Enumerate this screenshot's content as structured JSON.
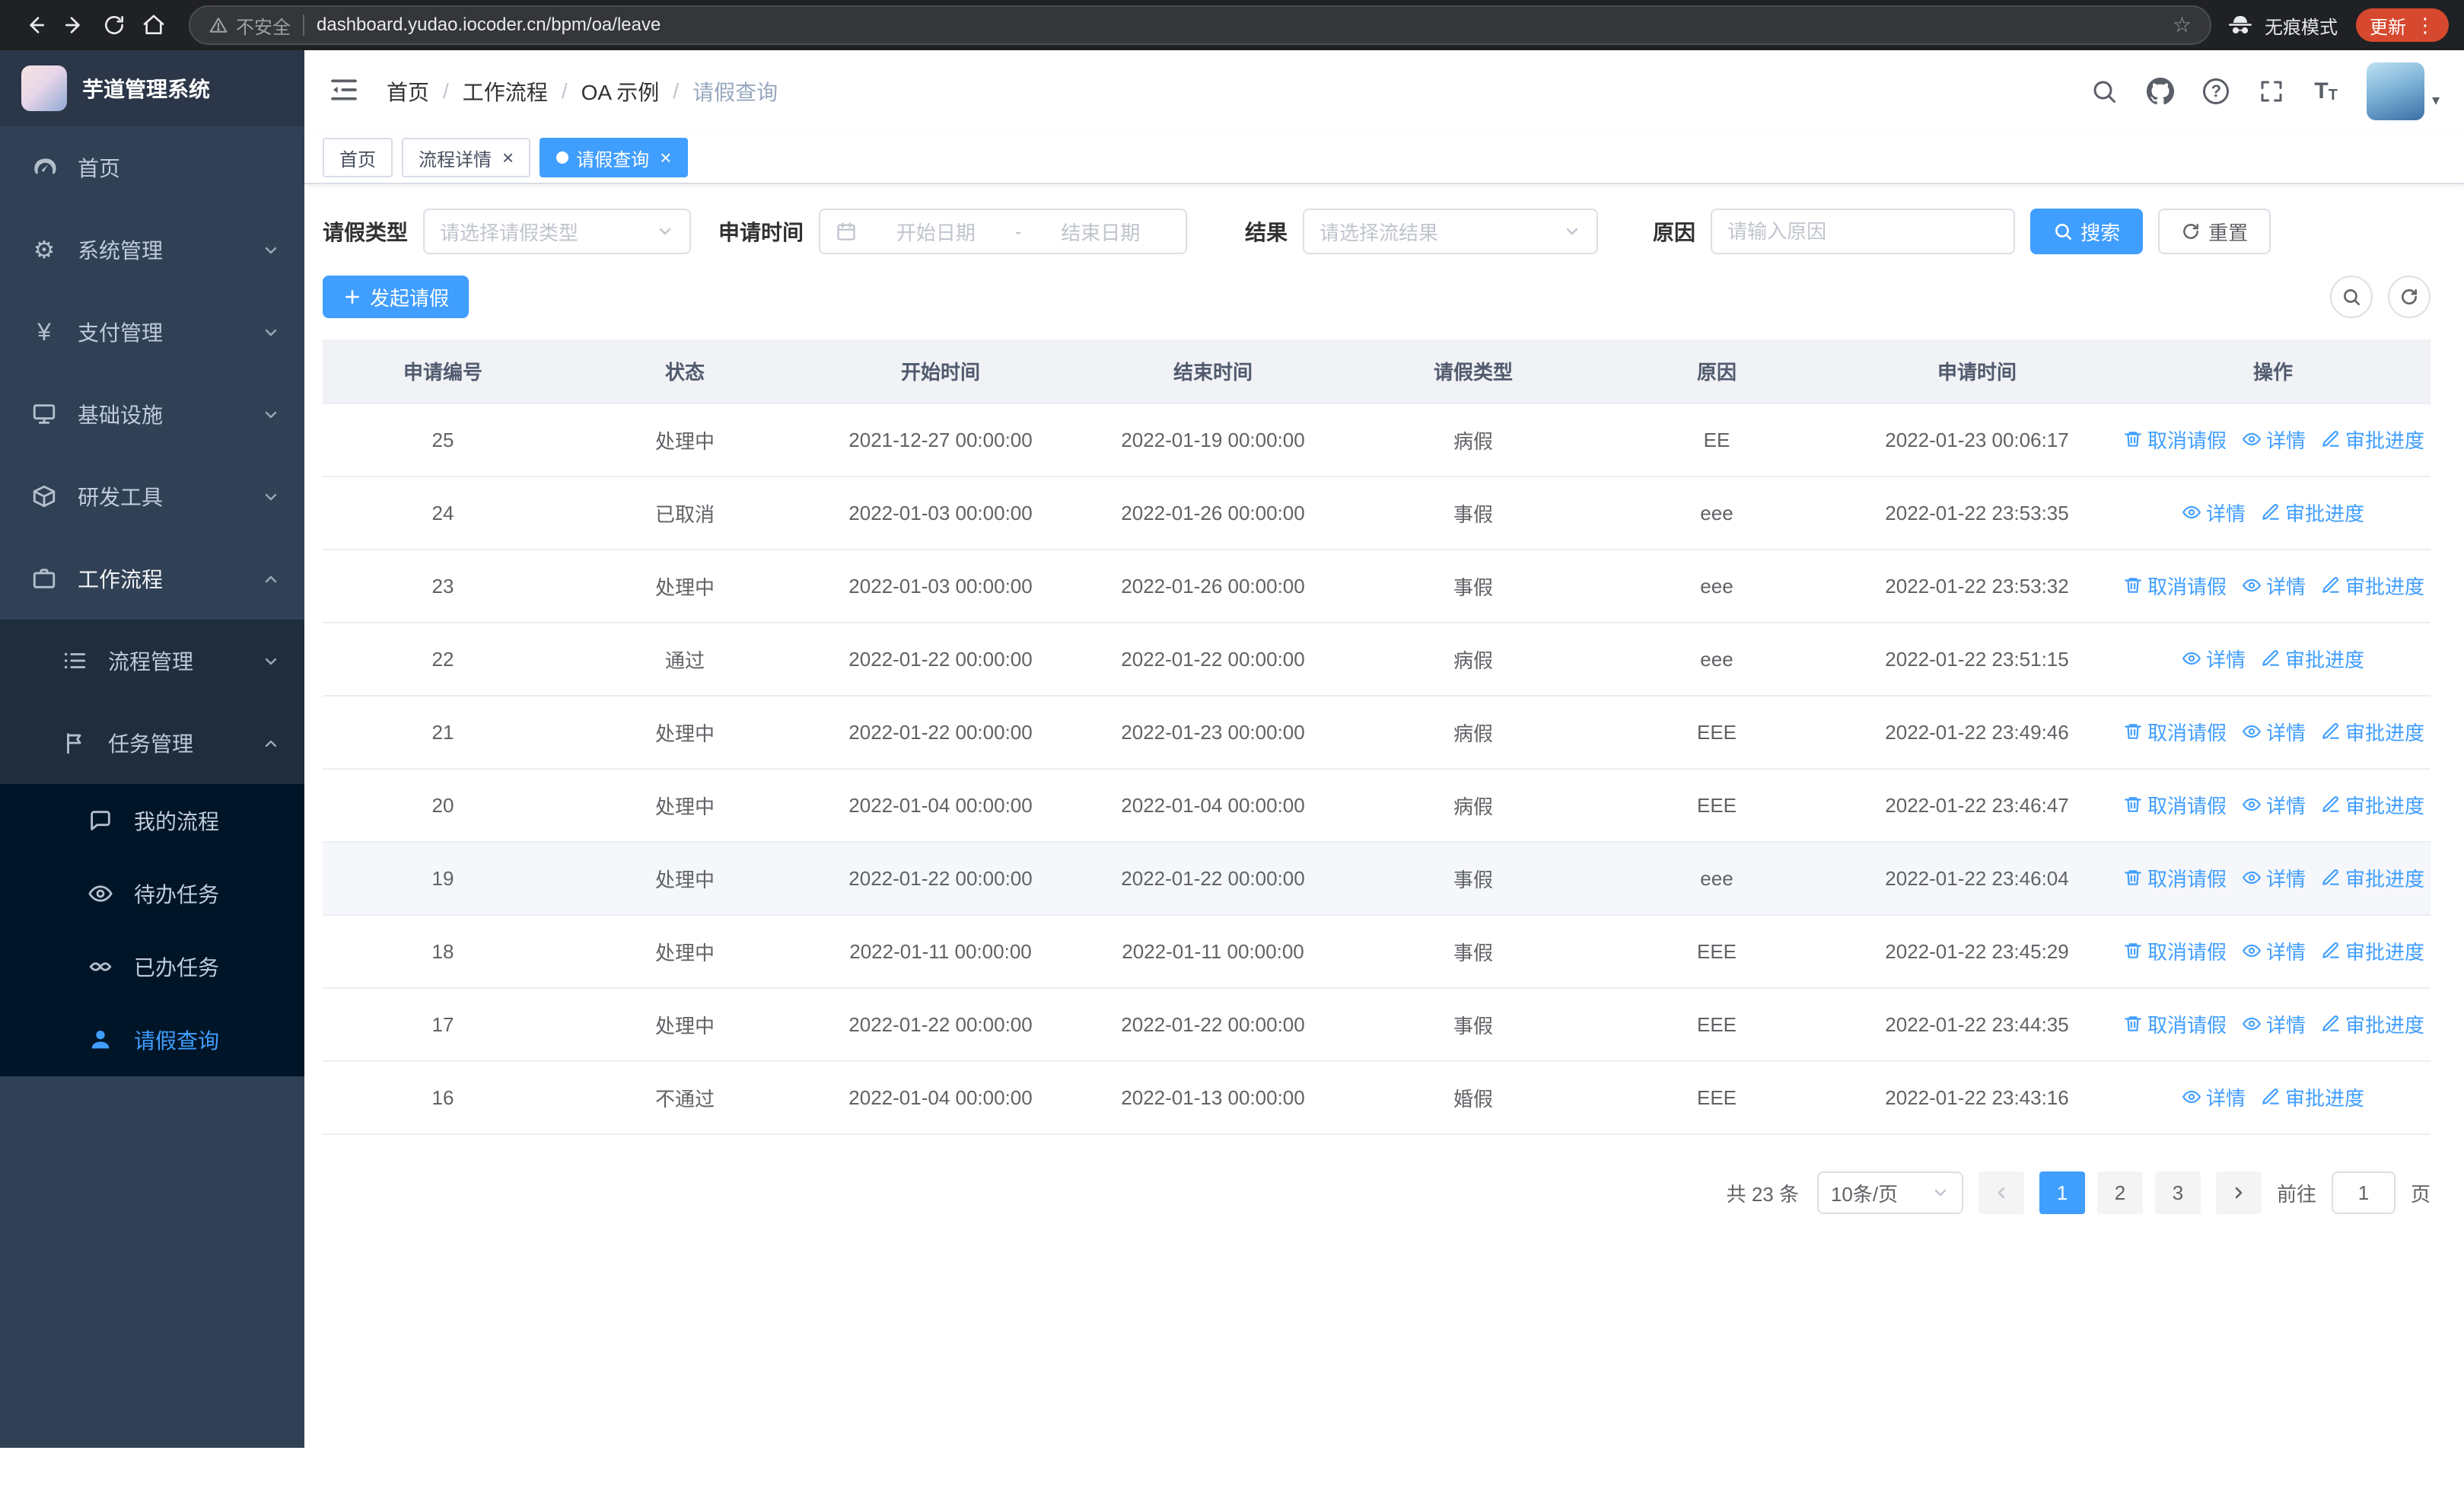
{
  "chrome": {
    "security_warning": "不安全",
    "url": "dashboard.yudao.iocoder.cn/bpm/oa/leave",
    "incognito_label": "无痕模式",
    "update_label": "更新"
  },
  "sidebar": {
    "logo_title": "芋道管理系统",
    "items": [
      "首页",
      "系统管理",
      "支付管理",
      "基础设施",
      "研发工具",
      "工作流程"
    ],
    "sub_items": [
      "流程管理",
      "任务管理"
    ],
    "leaf_items": [
      "我的流程",
      "待办任务",
      "已办任务",
      "请假查询"
    ]
  },
  "navbar": {
    "breadcrumb": [
      "首页",
      "工作流程",
      "OA 示例",
      "请假查询"
    ]
  },
  "tabs": [
    "首页",
    "流程详情",
    "请假查询"
  ],
  "filters": {
    "leave_type_label": "请假类型",
    "leave_type_placeholder": "请选择请假类型",
    "apply_time_label": "申请时间",
    "start_date_placeholder": "开始日期",
    "range_separator": "-",
    "end_date_placeholder": "结束日期",
    "result_label": "结果",
    "result_placeholder": "请选择流结果",
    "reason_label": "原因",
    "reason_placeholder": "请输入原因",
    "search_button": "搜索",
    "reset_button": "重置"
  },
  "toolbar": {
    "create_button": "发起请假"
  },
  "table": {
    "columns": [
      "申请编号",
      "状态",
      "开始时间",
      "结束时间",
      "请假类型",
      "原因",
      "申请时间",
      "操作"
    ],
    "action_cancel": "取消请假",
    "action_detail": "详情",
    "action_progress": "审批进度",
    "rows": [
      {
        "id": "25",
        "status": "处理中",
        "start": "2021-12-27 00:00:00",
        "end": "2022-01-19 00:00:00",
        "type": "病假",
        "reason": "EE",
        "applyTime": "2022-01-23 00:06:17",
        "cancelable": true,
        "hover": false
      },
      {
        "id": "24",
        "status": "已取消",
        "start": "2022-01-03 00:00:00",
        "end": "2022-01-26 00:00:00",
        "type": "事假",
        "reason": "eee",
        "applyTime": "2022-01-22 23:53:35",
        "cancelable": false,
        "hover": false
      },
      {
        "id": "23",
        "status": "处理中",
        "start": "2022-01-03 00:00:00",
        "end": "2022-01-26 00:00:00",
        "type": "事假",
        "reason": "eee",
        "applyTime": "2022-01-22 23:53:32",
        "cancelable": true,
        "hover": false
      },
      {
        "id": "22",
        "status": "通过",
        "start": "2022-01-22 00:00:00",
        "end": "2022-01-22 00:00:00",
        "type": "病假",
        "reason": "eee",
        "applyTime": "2022-01-22 23:51:15",
        "cancelable": false,
        "hover": false
      },
      {
        "id": "21",
        "status": "处理中",
        "start": "2022-01-22 00:00:00",
        "end": "2022-01-23 00:00:00",
        "type": "病假",
        "reason": "EEE",
        "applyTime": "2022-01-22 23:49:46",
        "cancelable": true,
        "hover": false
      },
      {
        "id": "20",
        "status": "处理中",
        "start": "2022-01-04 00:00:00",
        "end": "2022-01-04 00:00:00",
        "type": "病假",
        "reason": "EEE",
        "applyTime": "2022-01-22 23:46:47",
        "cancelable": true,
        "hover": false
      },
      {
        "id": "19",
        "status": "处理中",
        "start": "2022-01-22 00:00:00",
        "end": "2022-01-22 00:00:00",
        "type": "事假",
        "reason": "eee",
        "applyTime": "2022-01-22 23:46:04",
        "cancelable": true,
        "hover": true
      },
      {
        "id": "18",
        "status": "处理中",
        "start": "2022-01-11 00:00:00",
        "end": "2022-01-11 00:00:00",
        "type": "事假",
        "reason": "EEE",
        "applyTime": "2022-01-22 23:45:29",
        "cancelable": true,
        "hover": false
      },
      {
        "id": "17",
        "status": "处理中",
        "start": "2022-01-22 00:00:00",
        "end": "2022-01-22 00:00:00",
        "type": "事假",
        "reason": "EEE",
        "applyTime": "2022-01-22 23:44:35",
        "cancelable": true,
        "hover": false
      },
      {
        "id": "16",
        "status": "不通过",
        "start": "2022-01-04 00:00:00",
        "end": "2022-01-13 00:00:00",
        "type": "婚假",
        "reason": "EEE",
        "applyTime": "2022-01-22 23:43:16",
        "cancelable": false,
        "hover": false
      }
    ]
  },
  "pagination": {
    "total_text": "共 23 条",
    "page_size": "10条/页",
    "pages": [
      "1",
      "2",
      "3"
    ],
    "active_page": "1",
    "goto_label": "前往",
    "goto_value": "1",
    "goto_suffix": "页"
  }
}
